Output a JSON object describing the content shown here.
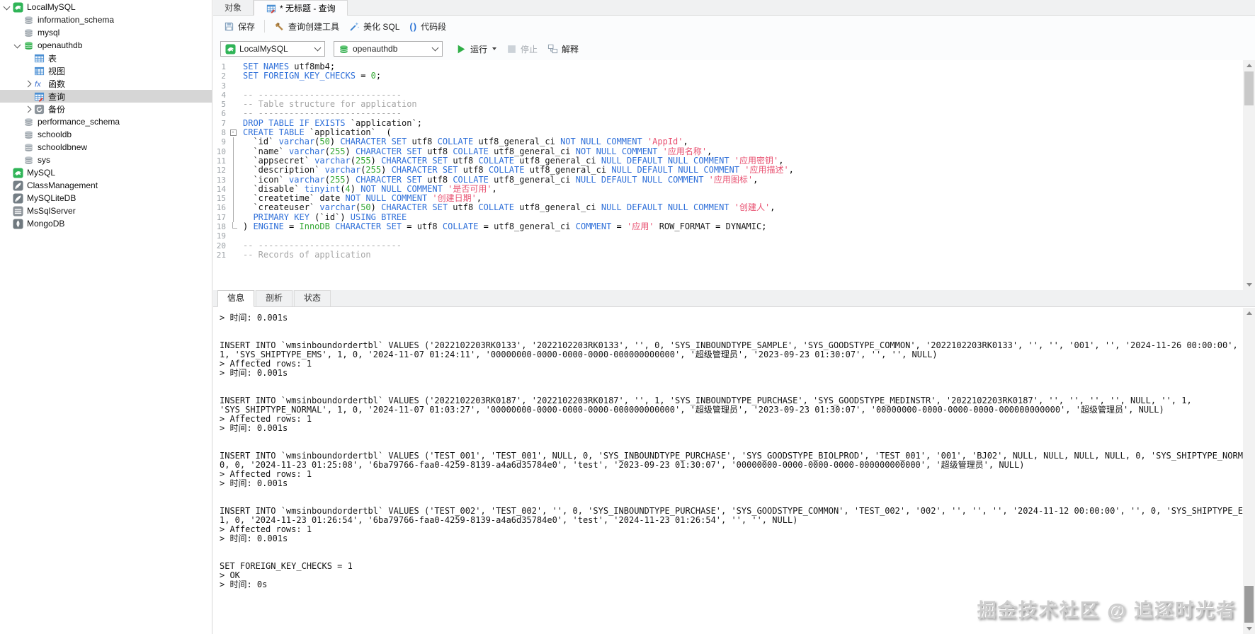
{
  "watermark": "掘金技术社区 @ 追逐时光者",
  "sidebar": {
    "items": [
      {
        "label": "LocalMySQL",
        "icon": "mysql-connection-icon",
        "depth": 0,
        "arrow": "expanded",
        "selected": false
      },
      {
        "label": "information_schema",
        "icon": "database-icon",
        "depth": 1,
        "arrow": null,
        "selected": false
      },
      {
        "label": "mysql",
        "icon": "database-icon",
        "depth": 1,
        "arrow": null,
        "selected": false
      },
      {
        "label": "openauthdb",
        "icon": "database-open-icon",
        "depth": 1,
        "arrow": "expanded",
        "selected": false
      },
      {
        "label": "表",
        "icon": "tables-icon",
        "depth": 2,
        "arrow": null,
        "selected": false
      },
      {
        "label": "视图",
        "icon": "views-icon",
        "depth": 2,
        "arrow": null,
        "selected": false
      },
      {
        "label": "函数",
        "icon": "functions-icon",
        "depth": 2,
        "arrow": "collapsed",
        "selected": false
      },
      {
        "label": "查询",
        "icon": "queries-icon",
        "depth": 2,
        "arrow": null,
        "selected": true
      },
      {
        "label": "备份",
        "icon": "backup-icon",
        "depth": 2,
        "arrow": "collapsed",
        "selected": false
      },
      {
        "label": "performance_schema",
        "icon": "database-icon",
        "depth": 1,
        "arrow": null,
        "selected": false
      },
      {
        "label": "schooldb",
        "icon": "database-icon",
        "depth": 1,
        "arrow": null,
        "selected": false
      },
      {
        "label": "schooldbnew",
        "icon": "database-icon",
        "depth": 1,
        "arrow": null,
        "selected": false
      },
      {
        "label": "sys",
        "icon": "database-icon",
        "depth": 1,
        "arrow": null,
        "selected": false
      },
      {
        "label": "MySQL",
        "icon": "mysql-connection-icon",
        "depth": 0,
        "arrow": null,
        "selected": false
      },
      {
        "label": "ClassManagement",
        "icon": "sqlite-connection-icon",
        "depth": 0,
        "arrow": null,
        "selected": false
      },
      {
        "label": "MySQLiteDB",
        "icon": "sqlite-connection-icon",
        "depth": 0,
        "arrow": null,
        "selected": false
      },
      {
        "label": "MsSqlServer",
        "icon": "mssql-connection-icon",
        "depth": 0,
        "arrow": null,
        "selected": false
      },
      {
        "label": "MongoDB",
        "icon": "mongodb-connection-icon",
        "depth": 0,
        "arrow": null,
        "selected": false
      }
    ]
  },
  "document_tabs": [
    {
      "label": "对象",
      "active": false,
      "icon": null
    },
    {
      "label": "* 无标题 - 查询",
      "active": true,
      "icon": "query-tab-icon"
    }
  ],
  "toolbar": {
    "save": "保存",
    "query_builder": "查询创建工具",
    "beautify_sql": "美化 SQL",
    "code_snippet": "代码段"
  },
  "connection_bar": {
    "connection": "LocalMySQL",
    "database": "openauthdb",
    "run": "运行",
    "stop": "停止",
    "explain": "解释"
  },
  "editor": {
    "lines": [
      "SET NAMES utf8mb4;",
      "SET FOREIGN_KEY_CHECKS = 0;",
      "",
      "-- ----------------------------",
      "-- Table structure for application",
      "-- ----------------------------",
      "DROP TABLE IF EXISTS `application`;",
      "CREATE TABLE `application`  (",
      "  `id` varchar(50) CHARACTER SET utf8 COLLATE utf8_general_ci NOT NULL COMMENT 'AppId',",
      "  `name` varchar(255) CHARACTER SET utf8 COLLATE utf8_general_ci NOT NULL COMMENT '应用名称',",
      "  `appsecret` varchar(255) CHARACTER SET utf8 COLLATE utf8_general_ci NULL DEFAULT NULL COMMENT '应用密钥',",
      "  `description` varchar(255) CHARACTER SET utf8 COLLATE utf8_general_ci NULL DEFAULT NULL COMMENT '应用描述',",
      "  `icon` varchar(255) CHARACTER SET utf8 COLLATE utf8_general_ci NULL DEFAULT NULL COMMENT '应用图标',",
      "  `disable` tinyint(4) NOT NULL COMMENT '是否可用',",
      "  `createtime` date NOT NULL COMMENT '创建日期',",
      "  `createuser` varchar(50) CHARACTER SET utf8 COLLATE utf8_general_ci NULL DEFAULT NULL COMMENT '创建人',",
      "  PRIMARY KEY (`id`) USING BTREE",
      ") ENGINE = InnoDB CHARACTER SET = utf8 COLLATE = utf8_general_ci COMMENT = '应用' ROW_FORMAT = DYNAMIC;",
      "",
      "-- ----------------------------",
      "-- Records of application"
    ],
    "gutter": [
      "",
      "",
      "",
      "",
      "",
      "",
      "",
      "box",
      "bar",
      "bar",
      "bar",
      "bar",
      "bar",
      "bar",
      "bar",
      "bar",
      "bar",
      "end",
      "",
      "",
      ""
    ]
  },
  "result_tabs": [
    {
      "label": "信息",
      "active": true
    },
    {
      "label": "剖析",
      "active": false
    },
    {
      "label": "状态",
      "active": false
    }
  ],
  "messages": {
    "lines": [
      "> 时间: 0.001s",
      "",
      "",
      "INSERT INTO `wmsinboundordertbl` VALUES ('2022102203RK0133', '2022102203RK0133', '', 0, 'SYS_INBOUNDTYPE_SAMPLE', 'SYS_GOODSTYPE_COMMON', '2022102203RK0133', '', '', '001', '', '2024-11-26 00:00:00', '',",
      "1, 'SYS_SHIPTYPE_EMS', 1, 0, '2024-11-07 01:24:11', '00000000-0000-0000-0000-000000000000', '超级管理员', '2023-09-23 01:30:07', '', '', NULL)",
      "> Affected rows: 1",
      "> 时间: 0.001s",
      "",
      "",
      "INSERT INTO `wmsinboundordertbl` VALUES ('2022102203RK0187', '2022102203RK0187', '', 1, 'SYS_INBOUNDTYPE_PURCHASE', 'SYS_GOODSTYPE_MEDINSTR', '2022102203RK0187', '', '', '', '', NULL, '', 1,",
      "'SYS_SHIPTYPE_NORMAL', 1, 0, '2024-11-07 01:03:27', '00000000-0000-0000-0000-000000000000', '超级管理员', '2023-09-23 01:30:07', '00000000-0000-0000-0000-000000000000', '超级管理员', NULL)",
      "> Affected rows: 1",
      "> 时间: 0.001s",
      "",
      "",
      "INSERT INTO `wmsinboundordertbl` VALUES ('TEST_001', 'TEST_001', NULL, 0, 'SYS_INBOUNDTYPE_PURCHASE', 'SYS_GOODSTYPE_BIOLPROD', 'TEST_001', '001', 'BJ02', NULL, NULL, NULL, NULL, 0, 'SYS_SHIPTYPE_NORMAL',",
      "0, 0, '2024-11-23 01:25:08', '6ba79766-faa0-4259-8139-a4a6d35784e0', 'test', '2023-09-23 01:30:07', '00000000-0000-0000-0000-000000000000', '超级管理员', NULL)",
      "> Affected rows: 1",
      "> 时间: 0.001s",
      "",
      "",
      "INSERT INTO `wmsinboundordertbl` VALUES ('TEST_002', 'TEST_002', '', 0, 'SYS_INBOUNDTYPE_PURCHASE', 'SYS_GOODSTYPE_COMMON', 'TEST_002', '002', '', '', '', '2024-11-12 00:00:00', '', 0, 'SYS_SHIPTYPE_EMS',",
      "1, 0, '2024-11-23 01:26:54', '6ba79766-faa0-4259-8139-a4a6d35784e0', 'test', '2024-11-23 01:26:54', '', '', NULL)",
      "> Affected rows: 1",
      "> 时间: 0.001s",
      "",
      "",
      "SET FOREIGN_KEY_CHECKS = 1",
      "> OK",
      "> 时间: 0s"
    ]
  },
  "icons": {
    "code_snippet_glyph": "()",
    "tree": [
      "mysql-connection-icon",
      "database-icon",
      "database-open-icon",
      "tables-icon",
      "views-icon",
      "functions-icon",
      "queries-icon",
      "backup-icon",
      "sqlite-connection-icon",
      "mssql-connection-icon",
      "mongodb-connection-icon"
    ],
    "toolbar": [
      "save-icon",
      "query-builder-icon",
      "beautify-sql-icon",
      "code-snippet-icon",
      "run-icon",
      "stop-icon",
      "explain-icon",
      "chevron-down-icon"
    ]
  },
  "colors": {
    "keyword": "#2e6fd9",
    "string": "#e85070",
    "number": "#33a833",
    "comment": "#a6a6a6",
    "selected_row": "#d6d6d6",
    "run_green": "#2fae46",
    "accent_blue": "#2e75d6"
  }
}
